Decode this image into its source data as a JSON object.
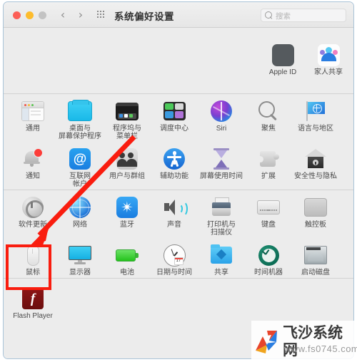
{
  "window": {
    "title": "系统偏好设置",
    "traffic_lights": {
      "close": "close-button",
      "minimize": "minimize-button",
      "zoom": "zoom-button"
    },
    "nav": {
      "back": "‹",
      "forward": "›"
    },
    "grid_icon": "grid-view-icon",
    "colors": {
      "window_bg": "#ececec",
      "titlebar_bg": "#ececec",
      "highlight_red": "#f91d0f",
      "accent_blue": "#1a7de0"
    }
  },
  "search": {
    "placeholder": "搜索",
    "value": ""
  },
  "sections": [
    {
      "name": "account",
      "items": [
        {
          "id": "apple-id",
          "label": "Apple ID",
          "icon": "apple-id-icon"
        },
        {
          "id": "family-sharing",
          "label": "家人共享",
          "icon": "family-sharing-icon"
        }
      ]
    },
    {
      "name": "personal",
      "items": [
        {
          "id": "general",
          "label": "通用",
          "icon": "general-icon"
        },
        {
          "id": "desktop-screensaver",
          "label": "桌面与\n屏幕保护程序",
          "icon": "desktop-screensaver-icon"
        },
        {
          "id": "dock-menubar",
          "label": "程序坞与\n菜单栏",
          "icon": "dock-menubar-icon"
        },
        {
          "id": "mission-control",
          "label": "调度中心",
          "icon": "mission-control-icon"
        },
        {
          "id": "siri",
          "label": "Siri",
          "icon": "siri-icon"
        },
        {
          "id": "spotlight",
          "label": "聚焦",
          "icon": "spotlight-icon"
        },
        {
          "id": "language-region",
          "label": "语言与地区",
          "icon": "language-region-icon"
        },
        {
          "id": "notifications",
          "label": "通知",
          "icon": "notifications-icon"
        },
        {
          "id": "internet-accounts",
          "label": "互联网\n帐户",
          "icon": "internet-accounts-icon"
        },
        {
          "id": "users-groups",
          "label": "用户与群组",
          "icon": "users-groups-icon"
        },
        {
          "id": "accessibility",
          "label": "辅助功能",
          "icon": "accessibility-icon"
        },
        {
          "id": "screen-time",
          "label": "屏幕使用时间",
          "icon": "screen-time-icon"
        },
        {
          "id": "extensions",
          "label": "扩展",
          "icon": "extensions-icon"
        },
        {
          "id": "security-privacy",
          "label": "安全性与隐私",
          "icon": "security-privacy-icon"
        }
      ]
    },
    {
      "name": "hardware",
      "items": [
        {
          "id": "software-update",
          "label": "软件更新",
          "icon": "software-update-icon"
        },
        {
          "id": "network",
          "label": "网络",
          "icon": "network-icon"
        },
        {
          "id": "bluetooth",
          "label": "蓝牙",
          "icon": "bluetooth-icon"
        },
        {
          "id": "sound",
          "label": "声音",
          "icon": "sound-icon"
        },
        {
          "id": "printers-scanners",
          "label": "打印机与\n扫描仪",
          "icon": "printer-icon"
        },
        {
          "id": "keyboard",
          "label": "键盘",
          "icon": "keyboard-icon"
        },
        {
          "id": "trackpad",
          "label": "触控板",
          "icon": "trackpad-icon"
        },
        {
          "id": "mouse",
          "label": "鼠标",
          "icon": "mouse-icon"
        },
        {
          "id": "displays",
          "label": "显示器",
          "icon": "display-icon",
          "highlighted": true
        },
        {
          "id": "battery",
          "label": "电池",
          "icon": "battery-icon"
        },
        {
          "id": "date-time",
          "label": "日期与时间",
          "icon": "clock-icon"
        },
        {
          "id": "sharing",
          "label": "共享",
          "icon": "sharing-folder-icon"
        },
        {
          "id": "time-machine",
          "label": "时间机器",
          "icon": "time-machine-icon"
        },
        {
          "id": "startup-disk",
          "label": "启动磁盘",
          "icon": "hard-disk-icon"
        }
      ]
    },
    {
      "name": "third-party",
      "items": [
        {
          "id": "flash-player",
          "label": "Flash Player",
          "icon": "flash-player-icon"
        }
      ]
    }
  ],
  "annotation": {
    "highlight_target": "显示器",
    "arrow": "red-pointer-arrow"
  },
  "watermark": {
    "site_name": "飞沙系统网",
    "url": "www.fs0745.com",
    "logo": "pinwheel-logo"
  },
  "date_badge": "17"
}
